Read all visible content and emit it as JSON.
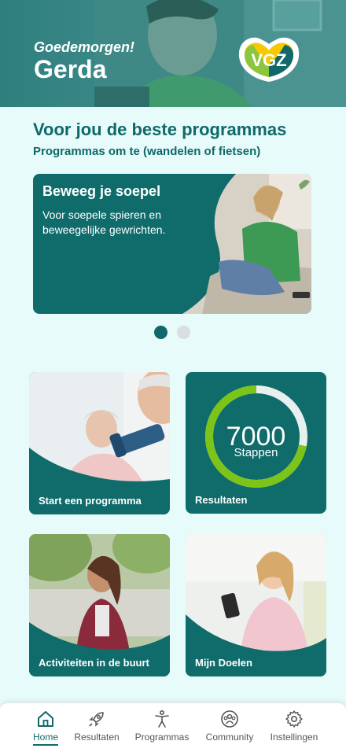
{
  "header": {
    "greeting": "Goedemorgen!",
    "name": "Gerda",
    "logo_text": "VGZ"
  },
  "programs": {
    "title": "Voor jou de beste programmas",
    "subtitle": "Programmas om te (wandelen of fietsen)",
    "hero": {
      "title": "Beweeg je soepel",
      "description": "Voor soepele spieren en beweegelijke gewrichten."
    },
    "carousel": {
      "count": 2,
      "active_index": 0
    }
  },
  "tiles": {
    "start": {
      "label": "Start een programma"
    },
    "results": {
      "label": "Resultaten",
      "steps_value": "7000",
      "steps_unit": "Stappen",
      "progress": 0.72
    },
    "activities": {
      "label": "Activiteiten in de buurt"
    },
    "goals": {
      "label": "Mijn Doelen"
    }
  },
  "nav": {
    "items": [
      {
        "label": "Home",
        "icon": "home-icon",
        "active": true
      },
      {
        "label": "Resultaten",
        "icon": "rocket-icon",
        "active": false
      },
      {
        "label": "Programmas",
        "icon": "person-icon",
        "active": false
      },
      {
        "label": "Community",
        "icon": "community-icon",
        "active": false
      },
      {
        "label": "Instellingen",
        "icon": "gear-icon",
        "active": false
      }
    ]
  },
  "colors": {
    "brand": "#10686a",
    "accent_green": "#7cc417",
    "background": "#e6fbfa"
  }
}
